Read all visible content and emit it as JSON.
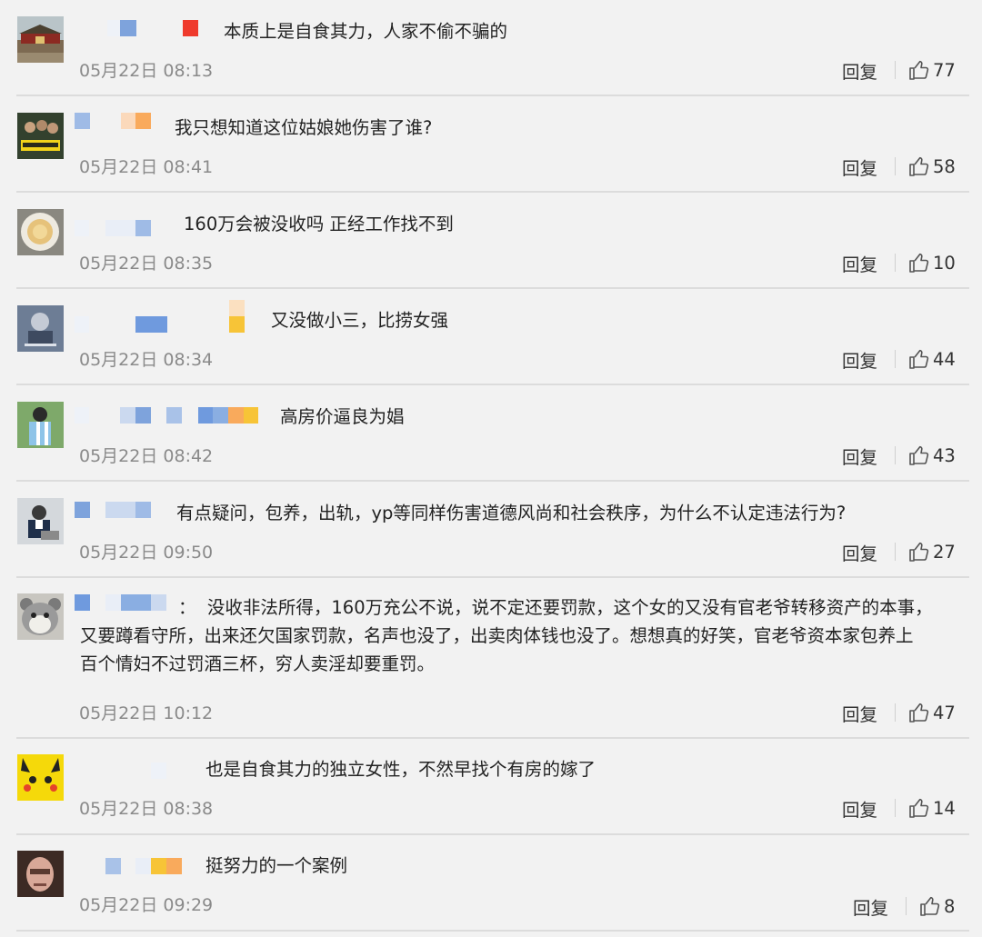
{
  "actions": {
    "reply_label": "回复"
  },
  "comments": [
    {
      "text": "本质上是自食其力，人家不偷不骗的",
      "time": "05月22日 08:13",
      "likes": "77",
      "avatar_icon": "tiananmen-gate-photo-icon"
    },
    {
      "text": "我只想知道这位姑娘她伤害了谁?",
      "time": "05月22日 08:41",
      "likes": "58",
      "avatar_icon": "movie-poster-icon"
    },
    {
      "text": "160万会被没收吗 正经工作找不到",
      "time": "05月22日 08:35",
      "likes": "10",
      "avatar_icon": "food-plate-icon"
    },
    {
      "text": "又没做小三，比捞女强",
      "time": "05月22日 08:34",
      "likes": "44",
      "avatar_icon": "portrait-poster-icon"
    },
    {
      "text": "高房价逼良为娼",
      "time": "05月22日 08:42",
      "likes": "43",
      "avatar_icon": "soccer-player-icon"
    },
    {
      "text": "有点疑问，包养，出轨，yp等同样伤害道德风尚和社会秩序，为什么不认定违法行为?",
      "time": "05月22日 09:50",
      "likes": "27",
      "avatar_icon": "man-at-laptop-icon"
    },
    {
      "text": "：  没收非法所得，160万充公不说，说不定还要罚款，这个女的又没有官老爷转移资产的本事，\n又要蹲看守所，出来还欠国家罚款，名声也没了，出卖肉体钱也没了。想想真的好笑，官老爷资本家包养上\n百个情妇不过罚酒三杯，穷人卖淫却要重罚。",
      "time": "05月22日 10:12",
      "likes": "47",
      "avatar_icon": "plush-hamster-icon"
    },
    {
      "text": "也是自食其力的独立女性，不然早找个有房的嫁了",
      "time": "05月22日 08:38",
      "likes": "14",
      "avatar_icon": "pikachu-icon"
    },
    {
      "text": "挺努力的一个案例",
      "time": "05月22日 09:29",
      "likes": "8",
      "avatar_icon": "man-face-photo-icon"
    }
  ]
}
